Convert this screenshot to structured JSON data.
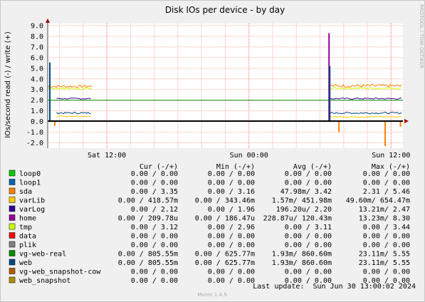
{
  "chart_data": {
    "type": "line",
    "title": "Disk IOs per device - by day",
    "ylabel": "IOs/second read (-) / write (+)",
    "ylim": [
      -2.5,
      9.2
    ],
    "yticks": [
      "9.0",
      "8.0",
      "7.0",
      "6.0",
      "5.0",
      "4.0",
      "3.0",
      "2.0",
      "1.0",
      "0.0",
      "-1.0",
      "-2.0"
    ],
    "ytick_values": [
      9,
      8,
      7,
      6,
      5,
      4,
      3,
      2,
      1,
      0,
      -1,
      -2
    ],
    "xticks": [
      "Sat 12:00",
      "Sun 00:00",
      "Sun 12:00"
    ],
    "grid": true,
    "watermark": "RRDTOOL / TOBI OETIKER",
    "footer": "Munin 1.4.5",
    "last_update": "Last update:  Sun Jun 30 13:00:02 2024",
    "legend_header": {
      "cur": "Cur (-/+)",
      "min": "Min (-/+)",
      "avg": "Avg (-/+)",
      "max": "Max (-/+)"
    },
    "series": [
      {
        "name": "loop0",
        "color": "#00cc00",
        "cur": "0.00 /   0.00",
        "min": "0.00 /   0.00",
        "avg": "0.00 /   0.00",
        "max": "0.00 /   0.00"
      },
      {
        "name": "loop1",
        "color": "#0066b3",
        "cur": "0.00 /   0.00",
        "min": "0.00 /   0.00",
        "avg": "0.00 /   0.00",
        "max": "0.00 /   0.00"
      },
      {
        "name": "sda",
        "color": "#ff8000",
        "cur": "0.00 /   3.35",
        "min": "0.00 /   3.16",
        "avg": "47.98m/   3.42",
        "max": "2.31 /   5.46"
      },
      {
        "name": "varLib",
        "color": "#ffcc00",
        "cur": "0.00 / 418.57m",
        "min": "0.00 / 343.46m",
        "avg": "1.57m/ 451.98m",
        "max": "49.60m/ 654.47m"
      },
      {
        "name": "varLog",
        "color": "#330099",
        "cur": "0.00 /   2.12",
        "min": "0.00 /   1.96",
        "avg": "196.20u/   2.20",
        "max": "13.21m/   2.47"
      },
      {
        "name": "home",
        "color": "#990099",
        "cur": "0.00 / 209.78u",
        "min": "0.00 / 186.47u",
        "avg": "228.87u/ 120.43m",
        "max": "13.23m/   8.30"
      },
      {
        "name": "tmp",
        "color": "#ccff00",
        "cur": "0.00 /   3.12",
        "min": "0.00 /   2.96",
        "avg": "0.00 /   3.11",
        "max": "0.00 /   3.44"
      },
      {
        "name": "data",
        "color": "#ff0000",
        "cur": "0.00 /   0.00",
        "min": "0.00 /   0.00",
        "avg": "0.00 /   0.00",
        "max": "0.00 /   0.00"
      },
      {
        "name": "plik",
        "color": "#808080",
        "cur": "0.00 /   0.00",
        "min": "0.00 /   0.00",
        "avg": "0.00 /   0.00",
        "max": "0.00 /   0.00"
      },
      {
        "name": "vg-web-real",
        "color": "#008f00",
        "cur": "0.00 / 805.55m",
        "min": "0.00 / 625.77m",
        "avg": "1.93m/ 860.60m",
        "max": "23.11m/   5.55"
      },
      {
        "name": "web",
        "color": "#00487d",
        "cur": "0.00 / 805.55m",
        "min": "0.00 / 625.77m",
        "avg": "1.93m/ 860.60m",
        "max": "23.11m/   5.55"
      },
      {
        "name": "vg-web_snapshot-cow",
        "color": "#b35a00",
        "cur": "0.00 /   0.00",
        "min": "0.00 /   0.00",
        "avg": "0.00 /   0.00",
        "max": "0.00 /   0.00"
      },
      {
        "name": "web_snapshot",
        "color": "#b38f00",
        "cur": "0.00 /   0.00",
        "min": "0.00 /   0.00",
        "avg": "0.00 /   0.00",
        "max": "0.00 /   0.00"
      }
    ],
    "data_segments": [
      {
        "series": "sda",
        "start": 0.0,
        "end": 0.125,
        "level": 3.3,
        "noise": 0.12
      },
      {
        "series": "tmp",
        "start": 0.0,
        "end": 0.125,
        "level": 3.1,
        "noise": 0.1
      },
      {
        "series": "varLog",
        "start": 0.025,
        "end": 0.125,
        "level": 2.15,
        "noise": 0.06
      },
      {
        "series": "web",
        "start": 0.025,
        "end": 0.125,
        "level": 0.8,
        "noise": 0.08
      },
      {
        "series": "varLib",
        "start": 0.025,
        "end": 0.125,
        "level": 0.5,
        "noise": 0.05
      },
      {
        "series": "sda",
        "start": 0.792,
        "end": 1.0,
        "level": 3.35,
        "noise": 0.15
      },
      {
        "series": "tmp",
        "start": 0.792,
        "end": 1.0,
        "level": 3.12,
        "noise": 0.1
      },
      {
        "series": "varLog",
        "start": 0.792,
        "end": 1.0,
        "level": 2.15,
        "noise": 0.07
      },
      {
        "series": "web",
        "start": 0.792,
        "end": 1.0,
        "level": 0.8,
        "noise": 0.08
      },
      {
        "series": "varLib",
        "start": 0.792,
        "end": 1.0,
        "level": 0.45,
        "noise": 0.05
      }
    ],
    "spikes": [
      {
        "series": "web",
        "t": 0.006,
        "value": 5.55
      },
      {
        "series": "sda",
        "t": 0.02,
        "value": -0.4
      },
      {
        "series": "home",
        "t": 0.792,
        "value": 8.3
      },
      {
        "series": "web",
        "t": 0.794,
        "value": 5.2
      },
      {
        "series": "sda",
        "t": 0.82,
        "value": -1.0
      },
      {
        "series": "sda",
        "t": 0.95,
        "value": -2.31
      },
      {
        "series": "sda",
        "t": 0.993,
        "value": -0.5
      }
    ],
    "reference_line": {
      "series": "vg-web-real",
      "value": 2.0
    }
  }
}
